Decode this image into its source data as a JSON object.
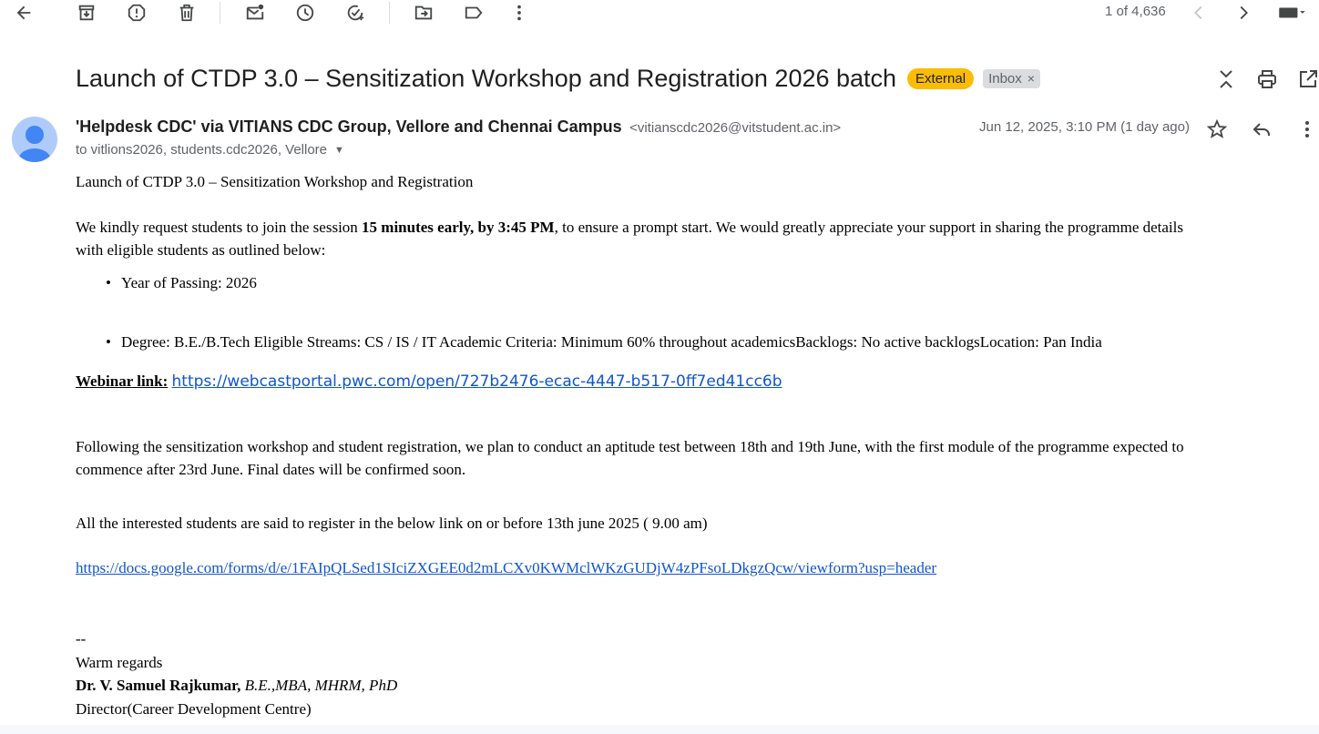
{
  "toolbar": {
    "icons": [
      "back-arrow-icon",
      "archive-icon",
      "report-spam-icon",
      "delete-icon",
      "mark-unread-icon",
      "snooze-icon",
      "add-to-tasks-icon",
      "move-to-icon",
      "label-icon",
      "more-vert-icon"
    ],
    "pager_text": "1 of 4,636"
  },
  "message": {
    "subject": "Launch of CTDP 3.0 – Sensitization Workshop and Registration 2026 batch",
    "labels": {
      "external": "External",
      "inbox": "Inbox",
      "inbox_remove": "×"
    },
    "sender_name": "'Helpdesk CDC' via VITIANS CDC Group, Vellore and Chennai Campus",
    "sender_email": "<vitianscdc2026@vitstudent.ac.in>",
    "to_line": "to vitlions2026, students.cdc2026, Vellore",
    "date": "Jun 12, 2025, 3:10 PM (1 day ago)"
  },
  "body": {
    "heading": "Launch of CTDP 3.0 – Sensitization Workshop and Registration",
    "para1_before": "We kindly request students to join the session ",
    "para1_bold": "15 minutes early, by 3:45 PM",
    "para1_after": ", to ensure a prompt start. We would greatly appreciate your support in sharing the programme details",
    "para1_line2": "with eligible students as outlined below:",
    "bullet1": "Year of Passing: 2026",
    "bullet2": "Degree: B.E./B.Tech  Eligible Streams: CS / IS / IT Academic Criteria: Minimum 60% throughout academicsBacklogs: No active backlogsLocation: Pan India",
    "webinar_label": "Webinar link:",
    "webinar_url": "https://webcastportal.pwc.com/open/727b2476-ecac-4447-b517-0ff7ed41cc6b",
    "para2_line1": "Following the sensitization workshop and student registration, we plan to conduct an aptitude test between 18th and 19th June, with the first module of the programme expected to",
    "para2_line2": "commence after 23rd June. Final dates will be confirmed soon.",
    "para3": "All the interested students are said to register in the below link on or before 13th june 2025 ( 9.00 am)",
    "form_url": "https://docs.google.com/forms/d/e/1FAIpQLSed1SIciZXGEE0d2mLCXv0KWMclWKzGUDjW4zPFsoLDkgzQcw/viewform?usp=header",
    "sig_dash": "--",
    "sig_regards": "Warm regards",
    "sig_name": "Dr. V. Samuel Rajkumar",
    "sig_degrees": " B.E.,MBA, MHRM, PhD",
    "sig_title": "Director(Career Development Centre)"
  }
}
